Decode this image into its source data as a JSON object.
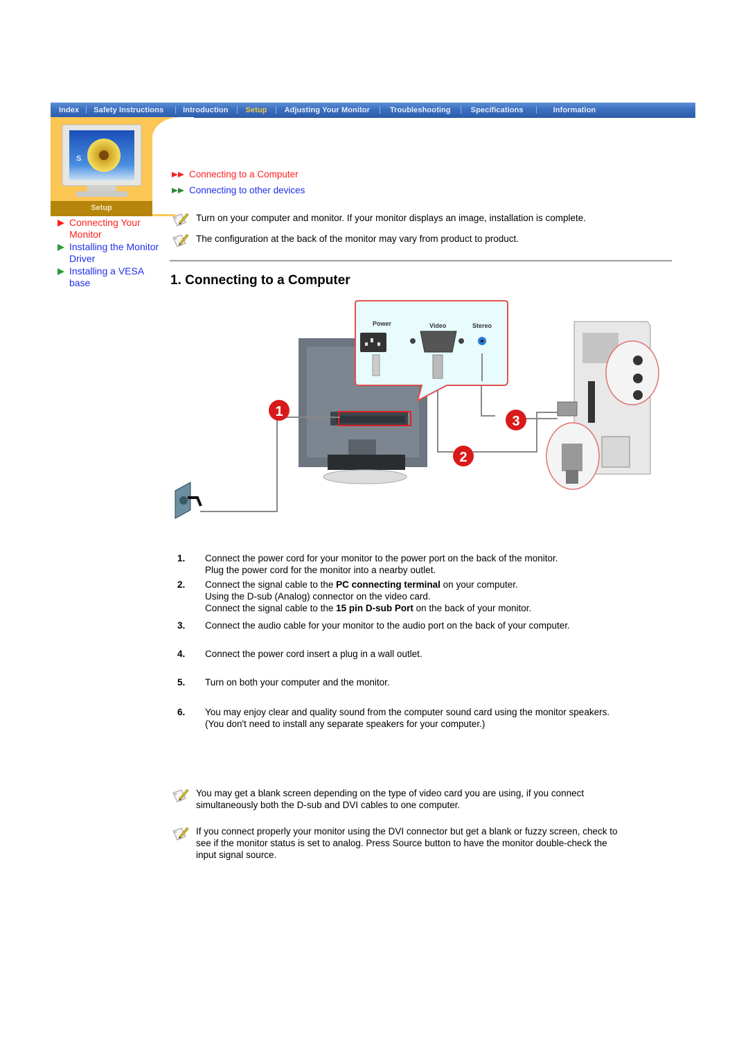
{
  "navbar": {
    "items": [
      {
        "label": "Index",
        "active": false
      },
      {
        "label": "Safety Instructions",
        "active": false
      },
      {
        "label": "Introduction",
        "active": false
      },
      {
        "label": "Setup",
        "active": true
      },
      {
        "label": "Adjusting Your Monitor",
        "active": false
      },
      {
        "label": "Troubleshooting",
        "active": false
      },
      {
        "label": "Specifications",
        "active": false
      },
      {
        "label": "Information",
        "active": false
      }
    ],
    "colors": {
      "background": "#3d70c0",
      "text": "#e8eef8",
      "active_text": "#f2c640"
    }
  },
  "sidebar": {
    "section_label": "Setup",
    "monitor_badge": "S",
    "links": [
      {
        "label": "Connecting Your Monitor",
        "active": true
      },
      {
        "label": "Installing the Monitor Driver",
        "active": false
      },
      {
        "label": "Installing a VESA base",
        "active": false
      }
    ],
    "colors": {
      "panel": "#fcc655",
      "section_bar": "#b5860b",
      "active_link": "#ff1f1f",
      "link": "#1f2fe8"
    }
  },
  "subnav": {
    "items": [
      {
        "label": "Connecting to a Computer",
        "active": true
      },
      {
        "label": "Connecting to other devices",
        "active": false
      }
    ]
  },
  "intro_notes": [
    "Turn on your computer and monitor. If your monitor displays an image, installation is complete.",
    "The configuration at the back of the monitor may vary from product to product."
  ],
  "heading": "1. Connecting to a Computer",
  "diagram": {
    "port_labels": [
      "Power",
      "Video",
      "Stereo"
    ],
    "callouts": [
      "1",
      "2",
      "3"
    ],
    "callout_color": "#d91a1a",
    "zoom_box_color": "#e8fbfd"
  },
  "steps": [
    {
      "num": "1.",
      "lines": [
        [
          {
            "t": "Connect the power cord for your monitor to the power port on the back of the monitor."
          }
        ],
        [
          {
            "t": "Plug the power cord for the monitor into a nearby outlet."
          }
        ]
      ]
    },
    {
      "num": "2.",
      "lines": [
        [
          {
            "t": "Connect the signal cable to the "
          },
          {
            "t": "PC connecting terminal",
            "b": true
          },
          {
            "t": " on your computer."
          }
        ],
        [
          {
            "t": "Using the D-sub (Analog) connector on the video card."
          }
        ],
        [
          {
            "t": "Connect the signal cable to the "
          },
          {
            "t": "15 pin D-sub Port",
            "b": true
          },
          {
            "t": " on the back of your monitor."
          }
        ]
      ]
    },
    {
      "num": "3.",
      "lines": [
        [
          {
            "t": "Connect the audio cable for your monitor to the audio port on the back of your computer."
          }
        ]
      ]
    },
    {
      "num": "4.",
      "lines": [
        [
          {
            "t": "Connect the power cord insert a plug in a wall outlet."
          }
        ]
      ]
    },
    {
      "num": "5.",
      "lines": [
        [
          {
            "t": "Turn on both your computer and the monitor."
          }
        ]
      ]
    },
    {
      "num": "6.",
      "lines": [
        [
          {
            "t": "You may enjoy clear and quality sound from the computer sound card using the monitor speakers."
          }
        ],
        [
          {
            "t": "(You don't need to install any separate speakers for your computer.)"
          }
        ]
      ]
    }
  ],
  "bottom_notes": [
    [
      "You may get a blank screen depending on the type of video card you are using, if you connect",
      "simultaneously both the D-sub and DVI cables to one computer."
    ],
    [
      "If you connect properly your monitor using the DVI connector but get a blank or fuzzy screen, check to",
      "see if the monitor status is set to analog. Press Source button to have the monitor double-check the",
      "input signal source."
    ]
  ]
}
